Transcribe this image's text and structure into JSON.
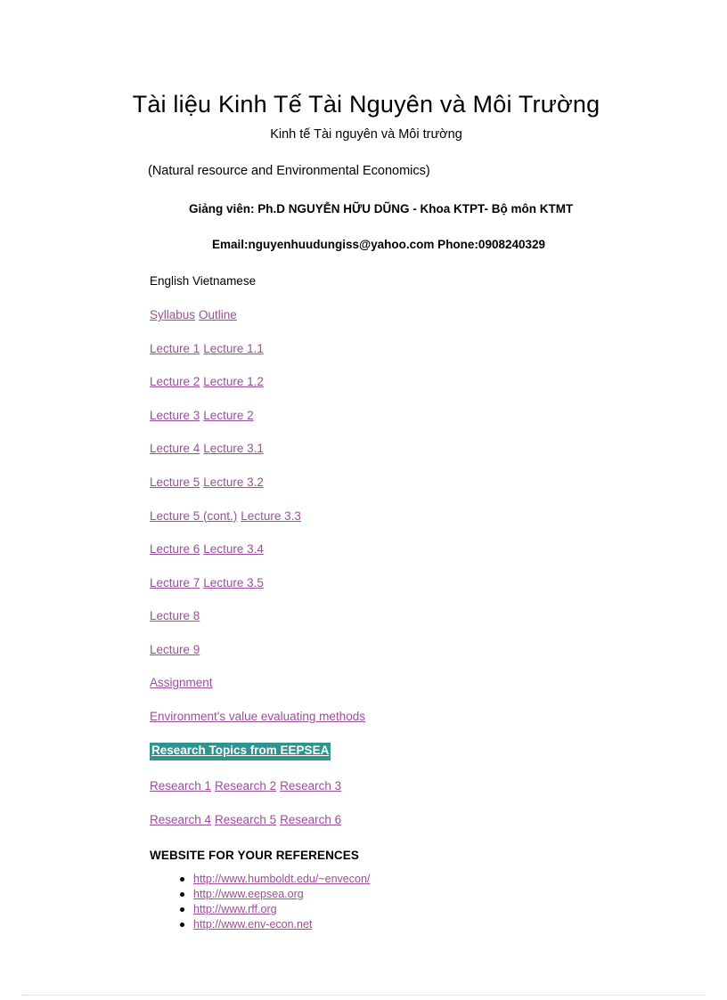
{
  "document": {
    "title": "Tài liệu Kinh Tế Tài Nguyên và Môi Trường",
    "subtitle_vi": "Kinh tế Tài nguyên  và Môi trường",
    "subtitle_en": "(Natural resource and Environmental  Economics)",
    "lecturer": "Giảng viên: Ph.D NGUYỄN  HỮU  DŨNG  - Khoa KTPT- Bộ môn KTMT",
    "contact": "Email:nguyenhuudungiss@yahoo.com  Phone:0908240329",
    "column_header": "English Vietnamese"
  },
  "link_rows": [
    {
      "links": [
        "Syllabus",
        "Outline "
      ]
    },
    {
      "links": [
        "Lecture 1",
        "Lecture 1.1"
      ]
    },
    {
      "links": [
        "Lecture 2",
        "Lecture 1.2"
      ]
    },
    {
      "links": [
        "Lecture 3",
        "Lecture 2"
      ]
    },
    {
      "links": [
        "Lecture 4",
        "Lecture 3.1"
      ]
    },
    {
      "links": [
        "Lecture 5",
        "Lecture 3.2"
      ]
    },
    {
      "links": [
        "Lecture 5 (cont.)",
        "Lecture 3.3"
      ]
    },
    {
      "links": [
        "Lecture 6",
        "Lecture 3.4"
      ]
    },
    {
      "links": [
        "Lecture 7",
        "Lecture 3.5"
      ]
    },
    {
      "links": [
        "Lecture 8"
      ]
    },
    {
      "links": [
        "Lecture 9"
      ]
    },
    {
      "links": [
        "Assignment"
      ]
    },
    {
      "links": [
        "Environment's  value  evaluating  methods"
      ]
    }
  ],
  "highlighted_row": {
    "label": "Research Topics from EEPSEA",
    "background_color": "#2e9490",
    "text_color": "#ffffff"
  },
  "research_rows": [
    {
      "links": [
        "Research 1",
        "Research 2",
        "Research 3"
      ]
    },
    {
      "links": [
        "Research 4",
        "Research 5",
        "Research 6"
      ]
    }
  ],
  "references": {
    "heading": "WEBSITE FOR YOUR REFERENCES",
    "urls": [
      "http://www.humboldt.edu/~envecon/ ",
      "http://www.eepsea.org ",
      "http://www.rff.org ",
      "http://www.env-econ.net "
    ]
  },
  "colors": {
    "link": "#9a4f99",
    "text": "#000000",
    "page_background": "#ffffff",
    "highlight": "#2e9490",
    "bottom_rule": "#9fe3e3"
  }
}
